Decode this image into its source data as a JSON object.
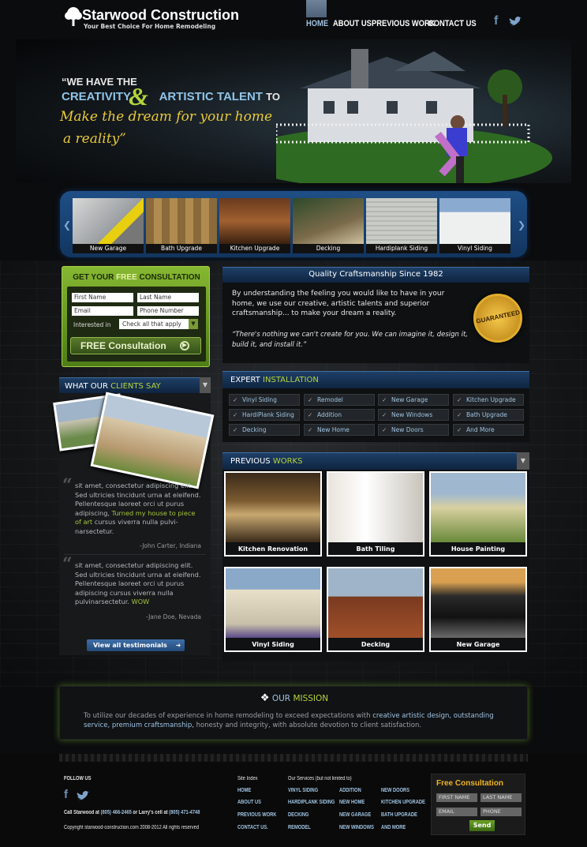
{
  "header": {
    "brand": "Starwood Construction",
    "tagline": "Your Best Choice For Home Remodeling",
    "nav": [
      "HOME",
      "ABOUT US",
      "PREVIOUS WORK",
      "CONTACT US"
    ]
  },
  "hero": {
    "line1": "“WE HAVE THE",
    "creativity": "CREATIVITY",
    "amp": "&",
    "artistic": "ARTISTIC TALENT",
    "to": "TO",
    "line3": "Make the dream for your home",
    "line4": "a reality”"
  },
  "carousel": [
    "New Garage",
    "Bath Upgrade",
    "Kitchen Upgrade",
    "Decking",
    "Hardiplank Siding",
    "Vinyl Siding"
  ],
  "consult": {
    "title_pre": "GET YOUR",
    "title_hl": "FREE",
    "title_post": "CONSULTATION",
    "first": "First Name",
    "last": "Last Name",
    "email": "Email",
    "phone": "Phone Number",
    "interest_label": "Interested in",
    "interest_value": "Check all that apply",
    "button": "FREE Consultation"
  },
  "quality": {
    "title": "Quality Craftsmanship Since 1982",
    "para": "By understanding the feeling you would like to have in your home, we use our creative, artistic talents and superior craftsmanship... to make your dream a reality.",
    "quote": "“There's nothing we can't create for you. We can imagine it, design it, build it, and install it.”",
    "seal": "GUARANTEED"
  },
  "expert": {
    "title_pre": "EXPERT",
    "title_hl": "INSTALLATION",
    "items": [
      "Vinyl Siding",
      "Remodel",
      "New Garage",
      "Kitchen Upgrade",
      "HardiPlank Siding",
      "Addition",
      "New Windows",
      "Bath Upgrade",
      "Decking",
      "New Home",
      "New Doors",
      "And More"
    ]
  },
  "clients": {
    "title_pre": "WHAT OUR",
    "title_hl": "CLIENTS SAY",
    "t1": "sit amet, consectetur adipiscing elit. Sed ultricies tincidunt urna at eleifend. Pellentesque laoreet orci ut purus adipiscing,",
    "t1_hl": "Turned my house to piece of art",
    "t1_end": "cursus viverra nulla pulvi-narsectetur.",
    "a1": "-John Carter, Indiana",
    "t2": "sit amet, consectetur adipiscing elit. Sed ultricies tincidunt urna at eleifend. Pellentesque laoreet orci ut purus adipiscing cursus viverra nulla pulvinarsectetur.",
    "t2_hl": "WOW",
    "a2": "-Jane Doe, Nevada",
    "button": "View all testimonials"
  },
  "works": {
    "title_pre": "PREVIOUS",
    "title_hl": "WORKS",
    "items": [
      "Kitchen Renovation",
      "Bath Tiling",
      "House Painting",
      "Vinyl Siding",
      "Decking",
      "New Garage"
    ]
  },
  "mission": {
    "title_pre": "OUR",
    "title_hl": "MISSION",
    "text_a": "To utilize our decades of experience in home remodeling to exceed expectations with",
    "hl1": "creative artistic design, outstanding service,",
    "hl2": "premium craftsmanship,",
    "text_b": "honesty and integrity, with absolute devotion to client satisfaction."
  },
  "footer": {
    "follow": "FOLLOW US",
    "call": "Call Starwood at",
    "phone1": "(805) 466-2465",
    "or": "or Larry's cell at",
    "phone2": "(805) 471-4748",
    "copyright": "Copyright starwood-construction.com 2008-2012 All rights reserved",
    "site_index": "Site Index",
    "site_links": [
      "HOME",
      "ABOUT US",
      "PREVIOUS WORK",
      "CONTACT US."
    ],
    "services_title": "Our Services (but not limited to)",
    "services": [
      "VINYL SIDING",
      "HARDIPLANK SIDING",
      "DECKING",
      "REMODEL",
      "ADDITION",
      "NEW HOME",
      "NEW GARAGE",
      "NEW WINDOWS",
      "NEW DOORS",
      "KITCHEN UPGRADE",
      "BATH UPGRADE",
      "AND MORE"
    ],
    "consult_title": "Free Consultation",
    "first": "FIRST NAME",
    "last": "LAST NAME",
    "email": "EMAIL",
    "phone": "PHONE",
    "send": "Send"
  }
}
